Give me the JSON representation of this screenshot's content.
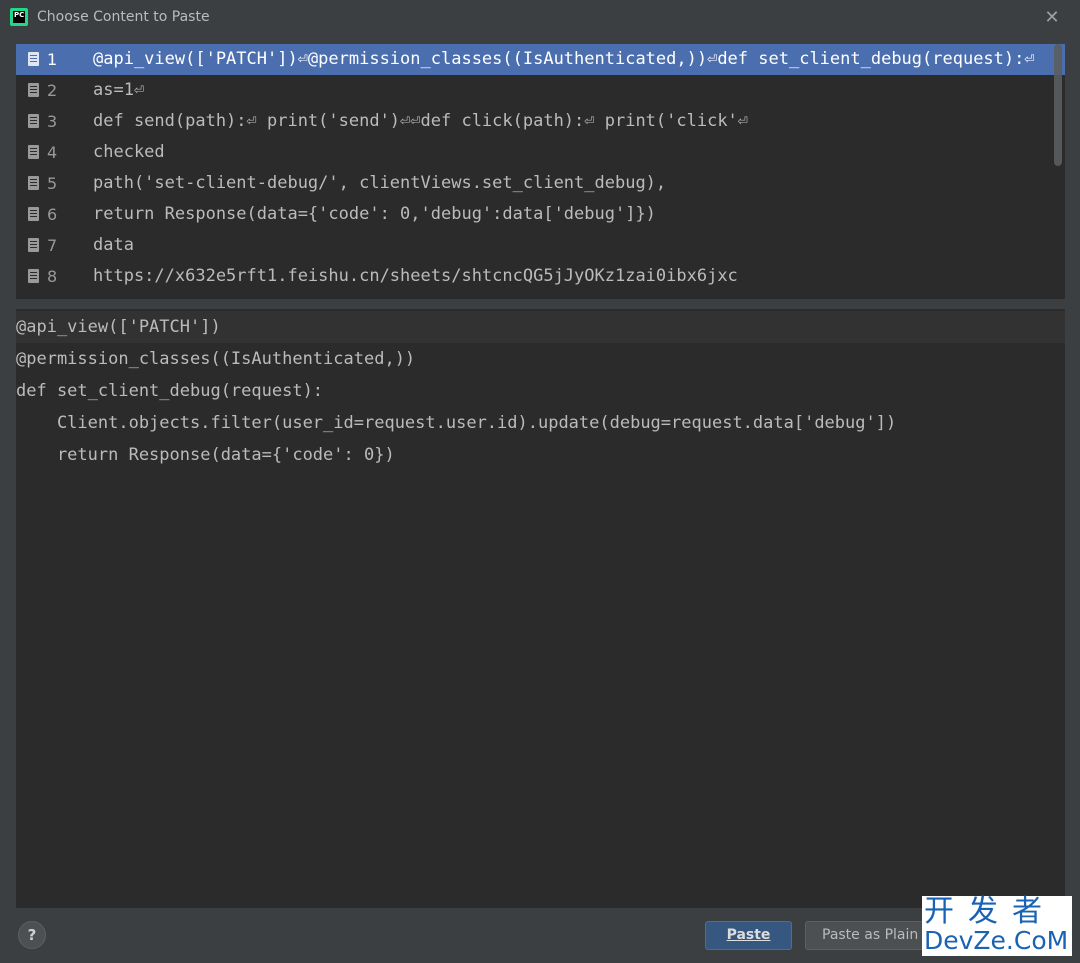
{
  "dialog": {
    "title": "Choose Content to Paste",
    "close_icon": "close-icon",
    "app_icon": "pycharm-icon",
    "app_icon_label": "PC"
  },
  "list": {
    "items": [
      {
        "num": "1",
        "text": "@api_view(['PATCH'])⏎@permission_classes((IsAuthenticated,))⏎def set_client_debug(request):⏎",
        "selected": true
      },
      {
        "num": "2",
        "text": "as=1⏎",
        "selected": false
      },
      {
        "num": "3",
        "text": "def send(path):⏎    print('send')⏎⏎def click(path):⏎    print('click'⏎",
        "selected": false
      },
      {
        "num": "4",
        "text": "checked",
        "selected": false
      },
      {
        "num": "5",
        "text": "path('set-client-debug/', clientViews.set_client_debug),",
        "selected": false
      },
      {
        "num": "6",
        "text": "return Response(data={'code': 0,'debug':data['debug']})",
        "selected": false
      },
      {
        "num": "7",
        "text": "data",
        "selected": false
      },
      {
        "num": "8",
        "text": "https://x632e5rft1.feishu.cn/sheets/shtcncQG5jJyOKz1zai0ibx6jxc",
        "selected": false
      }
    ]
  },
  "preview": {
    "lines": [
      "@api_view(['PATCH'])",
      "@permission_classes((IsAuthenticated,))",
      "def set_client_debug(request):",
      "    Client.objects.filter(user_id=request.user.id).update(debug=request.data['debug'])",
      "    return Response(data={'code': 0})"
    ]
  },
  "footer": {
    "help_label": "?",
    "paste_label": "Paste",
    "paste_plain_label": "Paste as Plain Text"
  },
  "watermark": {
    "line1": "开发者",
    "line2": "DevZe.CoM"
  },
  "colors": {
    "selection": "#4b6eaf",
    "panel_bg": "#2b2b2b",
    "window_bg": "#3c3f41",
    "primary_button": "#365880"
  }
}
